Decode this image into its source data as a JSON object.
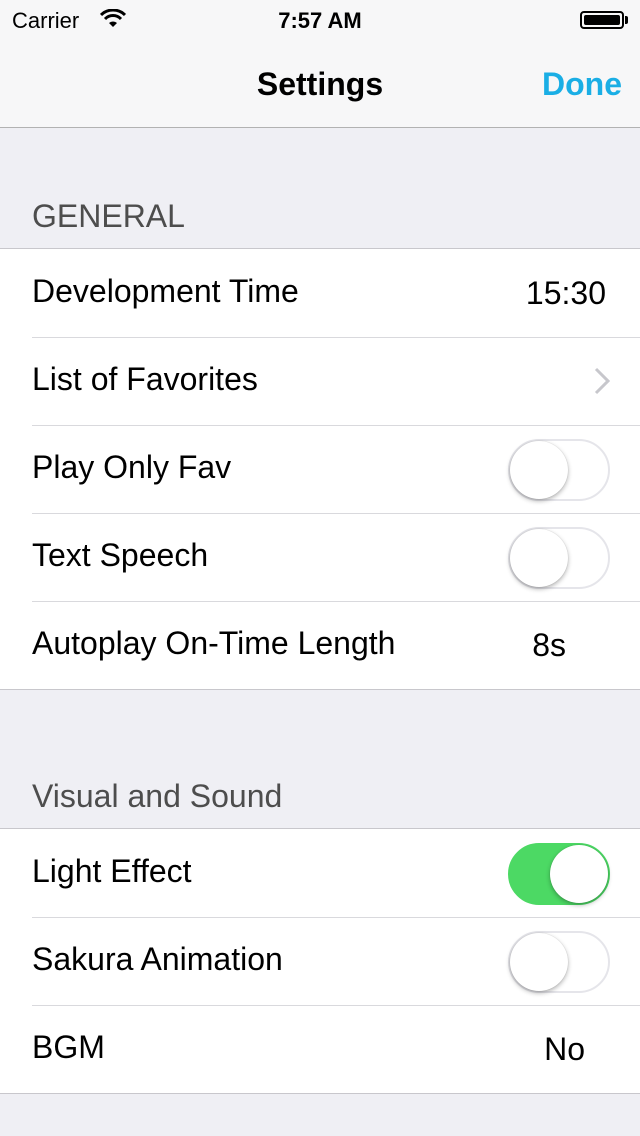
{
  "status": {
    "carrier": "Carrier",
    "time": "7:57 AM"
  },
  "nav": {
    "title": "Settings",
    "done_label": "Done"
  },
  "colors": {
    "accent": "#1aaee5",
    "switch_on": "#4cd964"
  },
  "sections": {
    "general": {
      "header": "GENERAL",
      "rows": {
        "development_time": {
          "label": "Development Time",
          "value": "15:30"
        },
        "favorites": {
          "label": "List of Favorites",
          "icon": "chevron-right-icon"
        },
        "play_only_fav": {
          "label": "Play Only Fav",
          "on": false
        },
        "text_speech": {
          "label": "Text Speech",
          "on": false
        },
        "autoplay": {
          "label": "Autoplay On-Time Length",
          "value": "8s"
        }
      }
    },
    "visual": {
      "header": "Visual and Sound",
      "rows": {
        "light_effect": {
          "label": "Light Effect",
          "on": true
        },
        "sakura": {
          "label": "Sakura Animation",
          "on": false
        },
        "bgm": {
          "label": "BGM",
          "value": "No"
        }
      }
    }
  }
}
